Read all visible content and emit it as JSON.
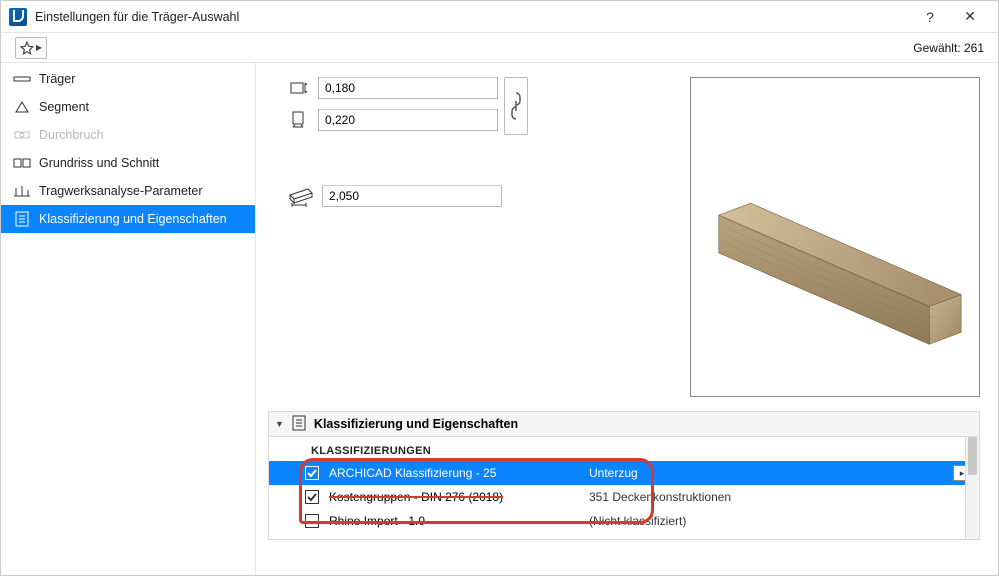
{
  "window": {
    "title": "Einstellungen für die Träger-Auswahl",
    "help": "?",
    "close": "✕"
  },
  "toolbar": {
    "selected_label": "Gewählt: 261"
  },
  "sidebar": {
    "items": [
      {
        "label": "Träger",
        "disabled": false,
        "selected": false
      },
      {
        "label": "Segment",
        "disabled": false,
        "selected": false
      },
      {
        "label": "Durchbruch",
        "disabled": true,
        "selected": false
      },
      {
        "label": "Grundriss und Schnitt",
        "disabled": false,
        "selected": false
      },
      {
        "label": "Tragwerksanalyse-Parameter",
        "disabled": false,
        "selected": false
      },
      {
        "label": "Klassifizierung und Eigenschaften",
        "disabled": false,
        "selected": true
      }
    ]
  },
  "dimensions": {
    "width": "0,180",
    "height": "0,220",
    "length": "2,050"
  },
  "section": {
    "title": "Klassifizierung und Eigenschaften",
    "group_label": "KLASSIFIZIERUNGEN",
    "rows": [
      {
        "checked": true,
        "name": "ARCHICAD Klassifizierung - 25",
        "value": "Unterzug",
        "selected": true,
        "struck_value": false
      },
      {
        "checked": true,
        "name": "Kostengruppen - DIN 276 (2018)",
        "value": "351 Deckenkonstruktionen",
        "selected": false,
        "struck_name": true
      },
      {
        "checked": false,
        "name": "Rhino Import - 1.0",
        "value": "(Nicht klassifiziert)",
        "selected": false
      }
    ]
  }
}
